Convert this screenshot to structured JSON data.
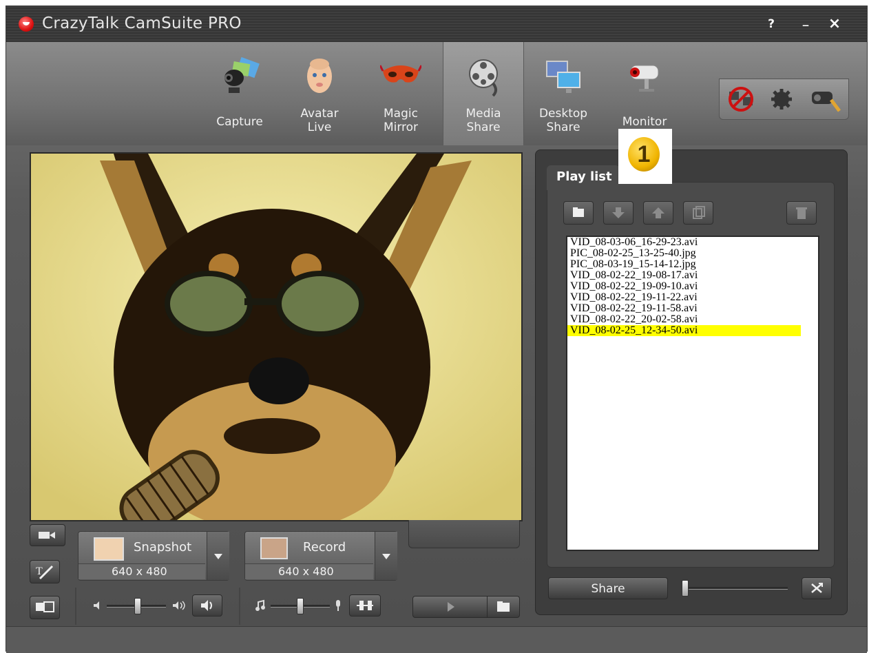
{
  "window": {
    "title": "CrazyTalk CamSuite PRO",
    "help_label": "?",
    "minimize_label": "_",
    "close_label": "×"
  },
  "nav": {
    "items": [
      {
        "label": "Capture",
        "icon": "webcam-icon"
      },
      {
        "label": "Avatar\nLive",
        "icon": "baby-avatar-icon"
      },
      {
        "label": "Magic\nMirror",
        "icon": "mask-icon"
      },
      {
        "label": "Media\nShare",
        "icon": "film-reel-icon"
      },
      {
        "label": "Desktop\nShare",
        "icon": "monitors-icon"
      },
      {
        "label": "Monitor",
        "icon": "security-camera-icon"
      }
    ],
    "active": "Media Share"
  },
  "controls": {
    "snapshot_label": "Snapshot",
    "snapshot_resolution": "640 x 480",
    "record_label": "Record",
    "record_resolution": "640 x 480"
  },
  "playlist": {
    "title": "Play list",
    "items": [
      "VID_08-03-06_16-29-23.avi",
      "PIC_08-02-25_13-25-40.jpg",
      "PIC_08-03-19_15-14-12.jpg",
      "VID_08-02-22_19-08-17.avi",
      "VID_08-02-22_19-09-10.avi",
      "VID_08-02-22_19-11-22.avi",
      "VID_08-02-22_19-11-58.avi",
      "VID_08-02-22_20-02-58.avi",
      "VID_08-02-25_12-34-50.avi"
    ],
    "selected_index": 8,
    "share_label": "Share"
  },
  "callout": {
    "number": "1"
  },
  "colors": {
    "selection": "#ffff00",
    "accent_red": "#d11111"
  }
}
